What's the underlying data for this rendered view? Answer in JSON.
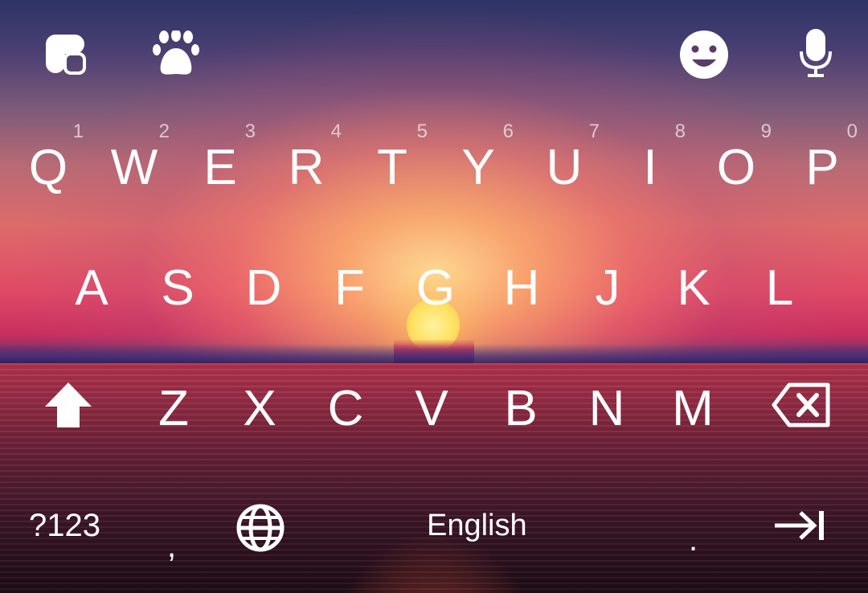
{
  "keyboard": {
    "top_bar": {
      "left_icons": [
        "clover-icon",
        "paw-icon"
      ],
      "right_icons": [
        "emoji-icon",
        "microphone-icon"
      ]
    },
    "rows": [
      {
        "keys": [
          {
            "label": "Q",
            "hint": "1"
          },
          {
            "label": "W",
            "hint": "2"
          },
          {
            "label": "E",
            "hint": "3"
          },
          {
            "label": "R",
            "hint": "4"
          },
          {
            "label": "T",
            "hint": "5"
          },
          {
            "label": "Y",
            "hint": "6"
          },
          {
            "label": "U",
            "hint": "7"
          },
          {
            "label": "I",
            "hint": "8"
          },
          {
            "label": "O",
            "hint": "9"
          },
          {
            "label": "P",
            "hint": "0"
          }
        ]
      },
      {
        "keys": [
          {
            "label": "A"
          },
          {
            "label": "S"
          },
          {
            "label": "D"
          },
          {
            "label": "F"
          },
          {
            "label": "G"
          },
          {
            "label": "H"
          },
          {
            "label": "J"
          },
          {
            "label": "K"
          },
          {
            "label": "L"
          }
        ]
      },
      {
        "keys": [
          {
            "label": "Z"
          },
          {
            "label": "X"
          },
          {
            "label": "C"
          },
          {
            "label": "V"
          },
          {
            "label": "B"
          },
          {
            "label": "N"
          },
          {
            "label": "M"
          }
        ],
        "left_icon": "shift-icon",
        "right_icon": "backspace-icon"
      }
    ],
    "bottom_row": {
      "symbols_label": "?123",
      "comma_label": ",",
      "language_icon": "globe-icon",
      "space_label": "English",
      "period_label": ".",
      "enter_icon": "next-arrow-icon"
    }
  }
}
